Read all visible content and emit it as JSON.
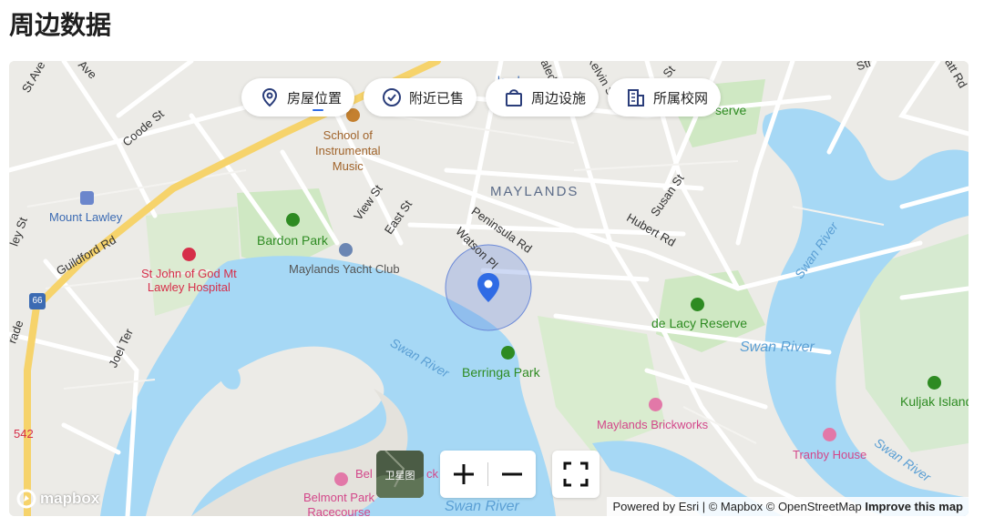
{
  "section": {
    "title": "周边数据"
  },
  "tabs": [
    {
      "label": "房屋位置",
      "icon": "location-pin-icon",
      "active": true
    },
    {
      "label": "附近已售",
      "icon": "check-shield-icon",
      "active": false
    },
    {
      "label": "周边设施",
      "icon": "shopping-bag-icon",
      "active": false
    },
    {
      "label": "所属校网",
      "icon": "building-icon",
      "active": false
    }
  ],
  "map": {
    "labels": {
      "suburb": "MAYLANDS",
      "mount_lawley": "Mount Lawley",
      "school": "School of\nInstrumental\nMusic",
      "bardon": "Bardon Park",
      "yacht": "Maylands Yacht Club",
      "hospital": "St John of God Mt\nLawley Hospital",
      "berringa": "Berringa Park",
      "delacy": "de Lacy Reserve",
      "swan_river_main": "Swan River",
      "swan_river_2": "Swan River",
      "swan_river_3": "Swan River",
      "swan_river_4": "Swan River",
      "swan_river_5": "Swan River",
      "brickworks": "Maylands Brickworks",
      "tranby": "Tranby House",
      "kuljak": "Kuljak Island",
      "belmont": "Belmont Park\nRacecourse",
      "bel": "Bel",
      "ck": "ck",
      "serve": "serve",
      "r542": "542",
      "route66": "66",
      "roads": {
        "guildford": "Guildford Rd",
        "coode": "Coode St",
        "view": "View St",
        "east": "East St",
        "peninsula": "Peninsula Rd",
        "watson": "Watson Pl",
        "hubert": "Hubert Rd",
        "susan": "Susan St",
        "kelvin": "Kelvin St",
        "joel": "Joel Ter",
        "st_ave": "St Ave",
        "ave": "Ave",
        "ley_st": "ley St",
        "rade": "rade",
        "caledo": "aledo",
        "st_top": "St",
        "str": "Str",
        "att": "att Rd",
        "land": "land"
      }
    },
    "controls": {
      "satellite_label": "卫星图",
      "zoom_in": "zoom-in",
      "zoom_out": "zoom-out",
      "fullscreen": "fullscreen"
    },
    "logo": "mapbox",
    "attribution": {
      "text": "Powered by Esri | © Mapbox © OpenStreetMap",
      "improve": "Improve this map"
    },
    "colors": {
      "water": "#a6d8f5",
      "land": "#ecebe7",
      "park": "#cfe8c3",
      "road": "#ffffff",
      "highway": "#f6d36b",
      "marker": "#2f6be5"
    }
  }
}
